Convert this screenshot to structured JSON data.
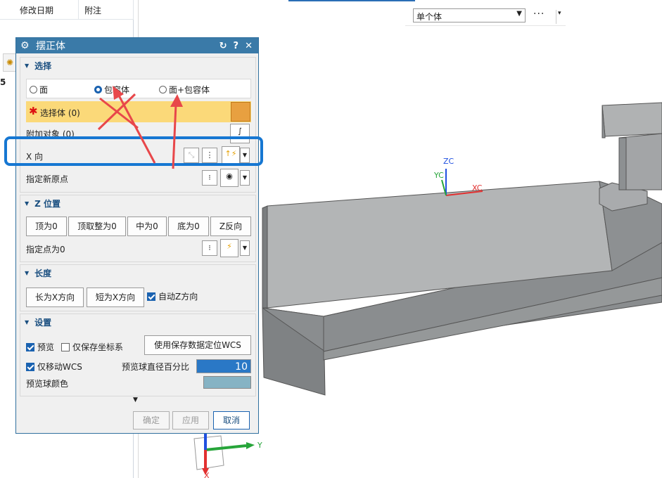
{
  "table": {
    "headers": [
      "修改日期",
      "附注"
    ],
    "row_marker": "5"
  },
  "viewport": {
    "body_mode": "单个体",
    "more_label": "···",
    "axes": {
      "zc": "ZC",
      "yc": "YC",
      "xc": "XC",
      "y": "Y",
      "x": "X"
    }
  },
  "dialog": {
    "title": "摆正体",
    "title_buttons": [
      "↻",
      "?",
      "✕"
    ],
    "select_section": {
      "header": "选择",
      "radio_options": [
        "面",
        "包容体",
        "面+包容体"
      ],
      "selected_radio": "包容体",
      "select_body_label": "选择体 (0)",
      "attach_label": "附加对象 (0)",
      "x_dir_label": "X 向",
      "new_origin_label": "指定新原点"
    },
    "z_section": {
      "header": "Z 位置",
      "buttons": [
        "顶为0",
        "顶取整为0",
        "中为0",
        "底为0",
        "Z反向"
      ],
      "point_label": "指定点为0"
    },
    "length_section": {
      "header": "长度",
      "buttons": [
        "长为X方向",
        "短为X方向"
      ],
      "auto_z_label": "自动Z方向",
      "auto_z_checked": true
    },
    "settings_section": {
      "header": "设置",
      "preview_label": "预览",
      "preview_checked": true,
      "save_coords_label": "仅保存坐标系",
      "save_coords_checked": false,
      "use_saved_button": "使用保存数据定位WCS",
      "move_wcs_label": "仅移动WCS",
      "move_wcs_checked": true,
      "ball_diameter_label": "预览球直径百分比",
      "ball_diameter_value": "10",
      "ball_color_label": "预览球颜色",
      "ball_color": "#86b3c4"
    },
    "footer": {
      "ok": "确定",
      "apply": "应用",
      "cancel": "取消"
    }
  },
  "colors": {
    "title_bar": "#3a7aa8",
    "highlight_row": "#fbd979",
    "annotation_red": "#e8474a",
    "annotation_blue": "#1677d2"
  }
}
